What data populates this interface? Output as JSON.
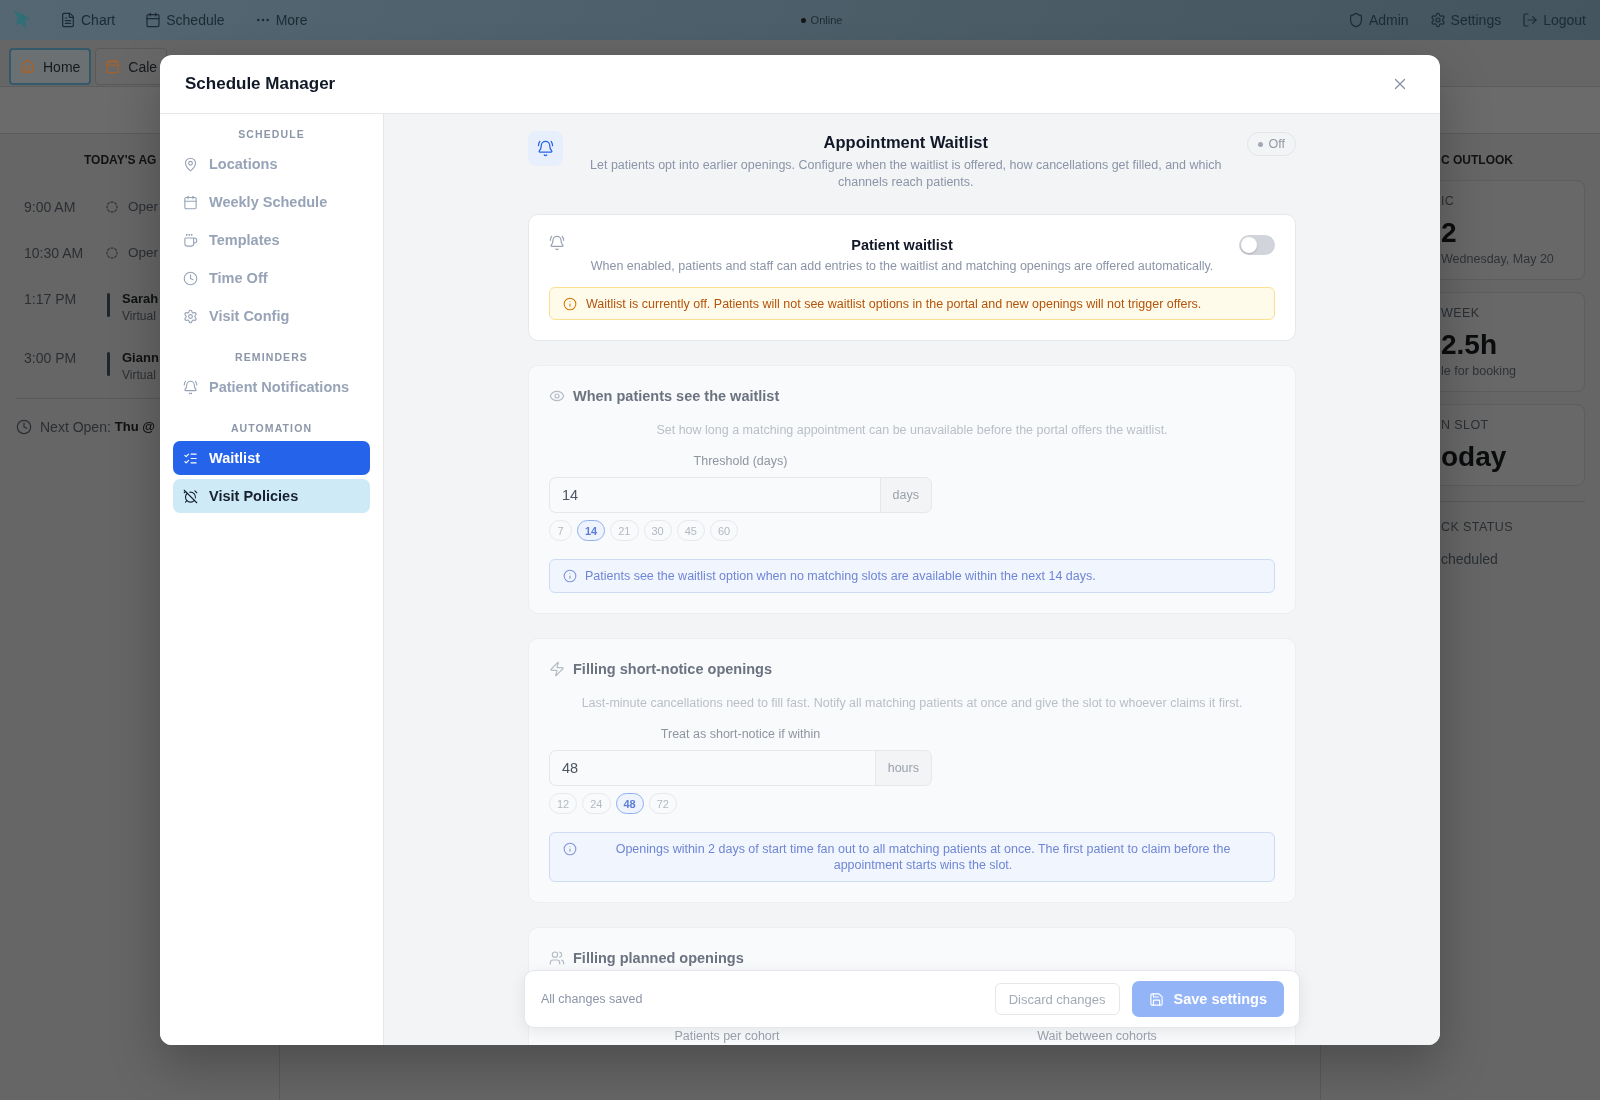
{
  "top_bar": {
    "nav": [
      {
        "label": "Chart"
      },
      {
        "label": "Schedule"
      },
      {
        "label": "More"
      }
    ],
    "status": "Online",
    "actions": [
      {
        "label": "Admin"
      },
      {
        "label": "Settings"
      },
      {
        "label": "Logout"
      }
    ]
  },
  "tabs": [
    {
      "label": "Home",
      "selected": true
    },
    {
      "label": "Cale",
      "selected": false
    }
  ],
  "agenda": {
    "title": "TODAY'S AG",
    "items": [
      {
        "kind": "opening",
        "time": "9:00 AM",
        "label": "Oper"
      },
      {
        "kind": "opening",
        "time": "10:30 AM",
        "label": "Oper"
      },
      {
        "kind": "appointment",
        "time": "1:17 PM",
        "label": "Sarah",
        "detail": "Virtual"
      },
      {
        "kind": "appointment",
        "time": "3:00 PM",
        "label": "Giann",
        "detail": "Virtual"
      }
    ],
    "next_open": {
      "label": "Next Open:",
      "value": "Thu @"
    }
  },
  "outlook": {
    "title": "C OUTLOOK",
    "cards": [
      {
        "label": "IC",
        "value": "2",
        "note": "Wednesday, May 20"
      },
      {
        "label": "WEEK",
        "value": "2.5h",
        "note": "le for booking"
      },
      {
        "label": "N SLOT",
        "value": "oday"
      }
    ],
    "status": {
      "label": "CK STATUS",
      "value": "cheduled"
    }
  },
  "modal": {
    "title": "Schedule Manager",
    "sidebar": [
      {
        "heading": "SCHEDULE",
        "items": [
          {
            "label": "Locations",
            "selected": false,
            "highlighted": false
          },
          {
            "label": "Weekly Schedule",
            "selected": false,
            "highlighted": false
          },
          {
            "label": "Templates",
            "selected": false,
            "highlighted": false
          },
          {
            "label": "Time Off",
            "selected": false,
            "highlighted": false
          },
          {
            "label": "Visit Config",
            "selected": false,
            "highlighted": false
          }
        ]
      },
      {
        "heading": "REMINDERS",
        "items": [
          {
            "label": "Patient Notifications",
            "selected": false,
            "highlighted": false
          }
        ]
      },
      {
        "heading": "AUTOMATION",
        "items": [
          {
            "label": "Waitlist",
            "selected": true,
            "highlighted": false
          },
          {
            "label": "Visit Policies",
            "selected": false,
            "highlighted": true
          }
        ]
      }
    ],
    "header": {
      "title": "Appointment Waitlist",
      "description": "Let patients opt into earlier openings. Configure when the waitlist is offered, how cancellations get filled, and which channels reach patients.",
      "status": "Off"
    },
    "waitlist_card": {
      "title": "Patient waitlist",
      "description": "When enabled, patients and staff can add entries to the waitlist and matching openings are offered automatically.",
      "on": false,
      "warning": "Waitlist is currently off. Patients will not see waitlist options in the portal and new openings will not trigger offers."
    },
    "sections": [
      {
        "kind": "field",
        "disabled": true,
        "title": "When patients see the waitlist",
        "description": "Set how long a matching appointment can be unavailable before the portal offers the waitlist.",
        "field_label": "Threshold (days)",
        "value": "14",
        "unit": "days",
        "presets": [
          {
            "label": "7",
            "selected": false
          },
          {
            "label": "14",
            "selected": true
          },
          {
            "label": "21",
            "selected": false
          },
          {
            "label": "30",
            "selected": false
          },
          {
            "label": "45",
            "selected": false
          },
          {
            "label": "60",
            "selected": false
          }
        ],
        "note": "Patients see the waitlist option when no matching slots are available within the next 14 days."
      },
      {
        "kind": "field",
        "disabled": true,
        "title": "Filling short-notice openings",
        "description": "Last-minute cancellations need to fill fast. Notify all matching patients at once and give the slot to whoever claims it first.",
        "field_label": "Treat as short-notice if within",
        "value": "48",
        "unit": "hours",
        "presets": [
          {
            "label": "12",
            "selected": false
          },
          {
            "label": "24",
            "selected": false
          },
          {
            "label": "48",
            "selected": true
          },
          {
            "label": "72",
            "selected": false
          }
        ],
        "note": "Openings within 2 days of start time fan out to all matching patients at once. The first patient to claim before the appointment starts wins the slot."
      },
      {
        "kind": "columns",
        "disabled": true,
        "title": "Filling planned openings",
        "columns": [
          "Patients per cohort",
          "Wait between cohorts"
        ]
      }
    ],
    "save_bar": {
      "status": "All changes saved",
      "discard": {
        "label": "Discard changes",
        "disabled": true
      },
      "save": {
        "label": "Save settings",
        "disabled": true
      }
    }
  }
}
